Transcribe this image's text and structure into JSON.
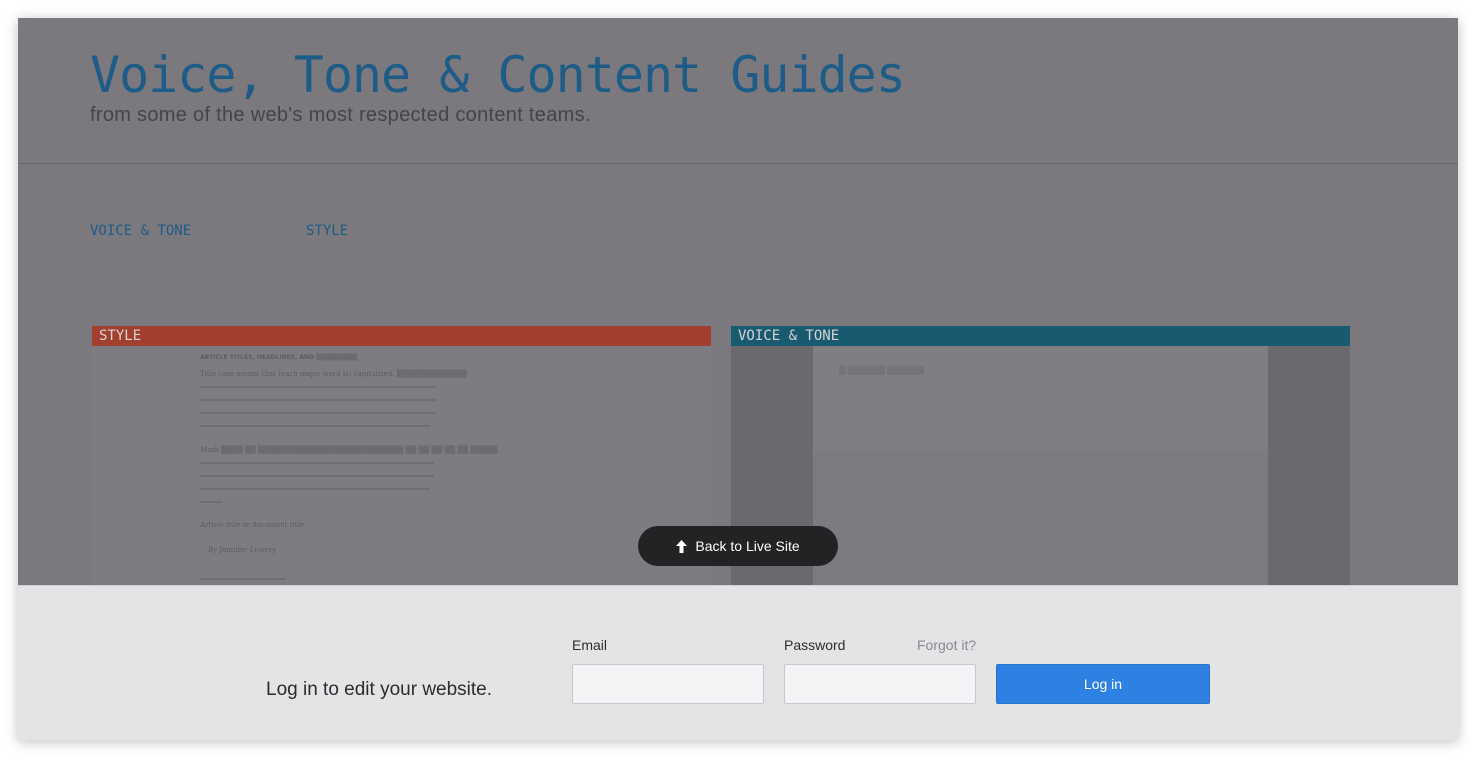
{
  "site": {
    "title": "Voice, Tone & Content Guides",
    "subtitle": "from some of the web's most respected content teams.",
    "nav": [
      "VOICE & TONE",
      "STYLE"
    ]
  },
  "cards": [
    {
      "label": "STYLE",
      "color": "#a2402f",
      "preview": {
        "heading": "ARTICLE TITLES, HEADLINES, AND ▒▒▒▒▒▒▒▒▒",
        "lines": [
          "Title case means that (each major word is) capitalized. ▒▒▒▒▒▒▒▒▒▒▒▒▒",
          "Mark ▒▒▒▒ ▒▒ ▒▒▒▒▒▒▒▒▒▒▒▒▒▒▒▒▒▒▒▒▒▒▒▒▒▒▒ ▒▒ ▒▒ ▒▒ ▒▒ ▒▒ ▒▒▒▒▒.",
          "Article title or document title",
          "By Jennifer Lowery"
        ]
      }
    },
    {
      "label": "VOICE & TONE",
      "color": "#1a5a70",
      "preview": {
        "text": "▒ ▒▒▒▒▒▒ ▒▒▒▒▒▒"
      }
    }
  ],
  "overlay": {
    "back_button": "Back to Live Site",
    "back_icon": "up-arrow-icon"
  },
  "login": {
    "prompt": "Log in to edit your website.",
    "email_label": "Email",
    "email_value": "",
    "password_label": "Password",
    "password_value": "",
    "forgot_label": "Forgot it?",
    "submit_label": "Log in",
    "accent_color": "#2e81e2"
  }
}
